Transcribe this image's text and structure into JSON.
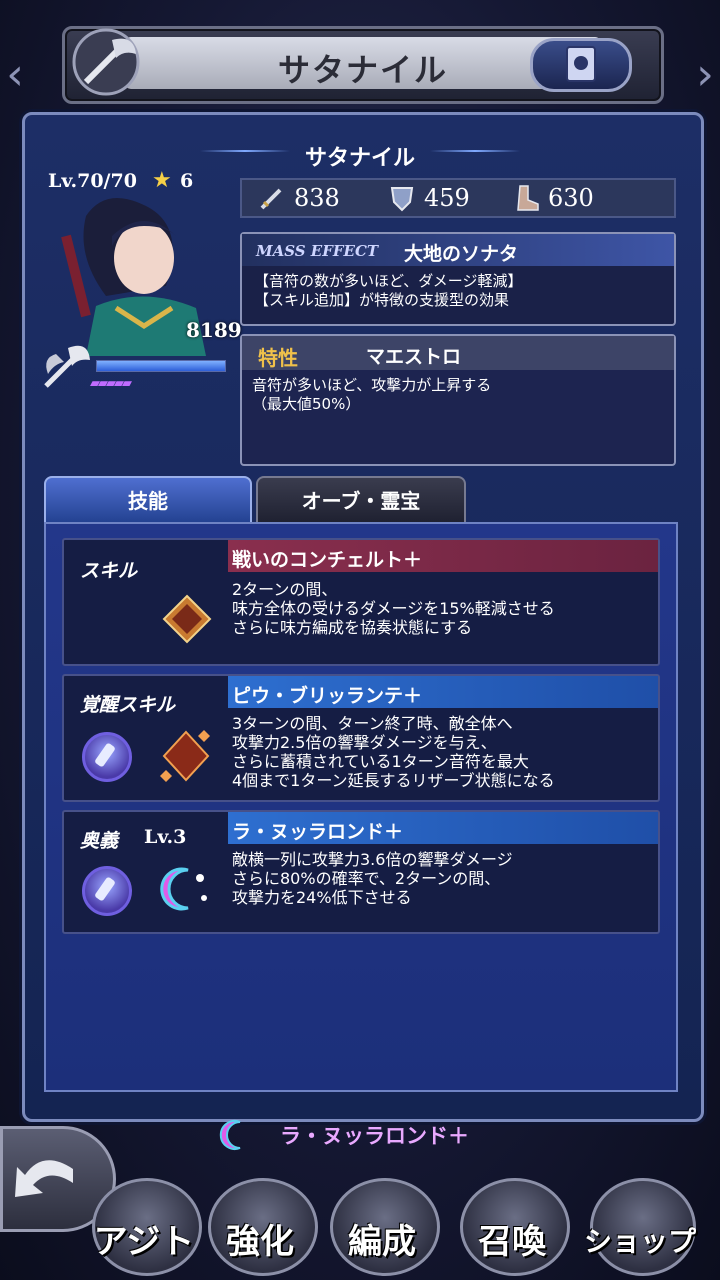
{
  "header": {
    "title": "サタナイル"
  },
  "character": {
    "name": "サタナイル",
    "level": "Lv.70/70",
    "rarity": "6",
    "power": "8189"
  },
  "stats": {
    "attack": "838",
    "defense": "459",
    "speed": "630"
  },
  "mass_effect": {
    "tag": "MASS EFFECT",
    "name": "大地のソナタ",
    "line1": "【音符の数が多いほど、ダメージ軽減】",
    "line2": "【スキル追加】が特徴の支援型の効果"
  },
  "trait": {
    "tag": "特性",
    "name": "マエストロ",
    "line1": "音符が多いほど、攻撃力が上昇する",
    "line2": "（最大値50%）"
  },
  "tabs": {
    "skills": "技能",
    "orb": "オーブ・霊宝"
  },
  "skill": {
    "label": "スキル",
    "name": "戦いのコンチェルト＋",
    "line1": "2ターンの間、",
    "line2": "味方全体の受けるダメージを15%軽減させる",
    "line3": "さらに味方編成を協奏状態にする"
  },
  "awakened": {
    "label": "覚醒スキル",
    "name": "ピウ・ブリッランテ＋",
    "line1": "3ターンの間、ターン終了時、敵全体へ",
    "line2": "攻撃力2.5倍の響撃ダメージを与え、",
    "line3": "さらに蓄積されている1ターン音符を最大",
    "line4": "4個まで1ターン延長するリザーブ状態になる"
  },
  "ougi": {
    "label": "奥義",
    "level": "Lv.3",
    "name": "ラ・ヌッラロンド＋",
    "line1": "敵横一列に攻撃力3.6倍の響撃ダメージ",
    "line2": "さらに80%の確率で、2ターンの間、",
    "line3": "攻撃力を24%低下させる"
  },
  "footer_ougi": "ラ・ヌッラロンド＋",
  "nav": {
    "home": "アジト",
    "enhance": "強化",
    "party": "編成",
    "summon": "召喚",
    "shop": "ショップ"
  },
  "colors": {
    "skill_bar": "#8a2f4e",
    "awakened_bar": "#2e6fd0",
    "ougi_bar": "#2e6fd0",
    "gold": "#f0c14a"
  }
}
